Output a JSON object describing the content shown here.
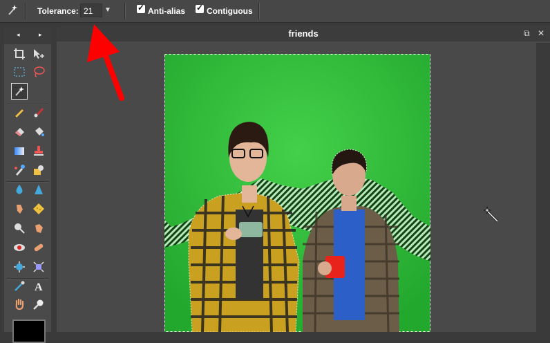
{
  "options_bar": {
    "tolerance_label": "Tolerance:",
    "tolerance_value": "21",
    "anti_alias_label": "Anti-alias",
    "contiguous_label": "Contiguous",
    "check_mark": "✓"
  },
  "toolbox": {
    "nav_left": "◂",
    "nav_right": "▸",
    "primary_color": "#000000"
  },
  "document": {
    "title": "friends",
    "restore_icon": "⧉",
    "close_icon": "✕"
  },
  "colors": {
    "chroma_green": "#2fbf3a",
    "annotation_arrow": "#ff0000",
    "toolbar_bg": "#474747"
  }
}
